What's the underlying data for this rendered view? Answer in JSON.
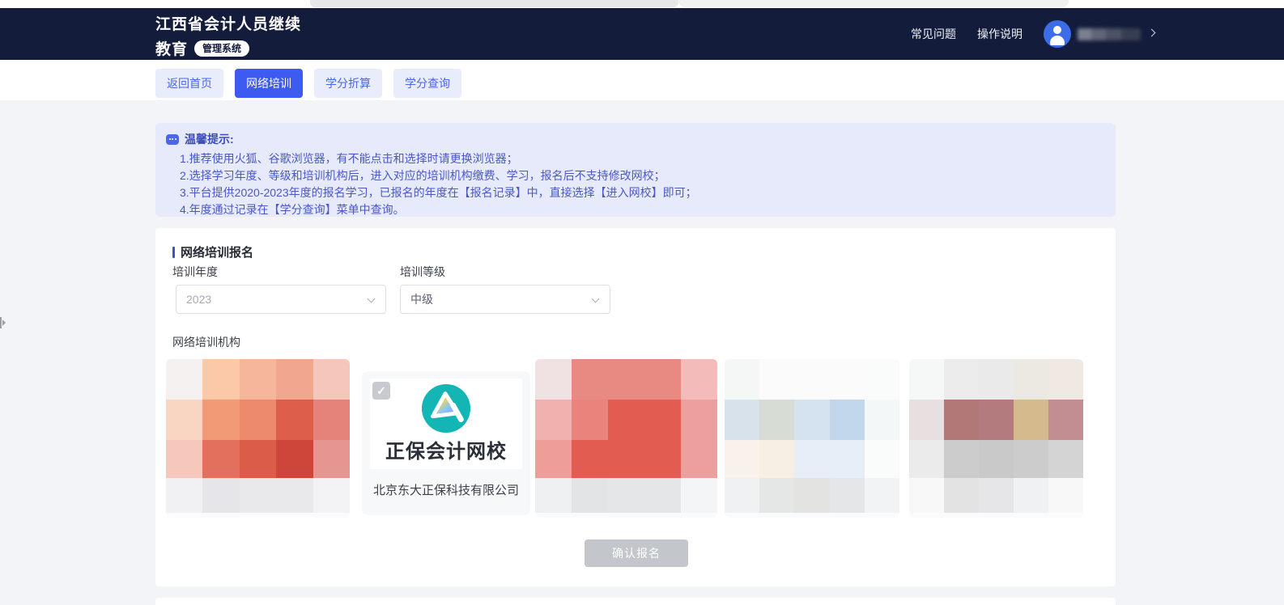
{
  "header": {
    "title_line1": "江西省会计人员继续",
    "title_line2": "教育",
    "badge": "管理系统",
    "links": [
      {
        "label": "常见问题"
      },
      {
        "label": "操作说明"
      }
    ]
  },
  "nav": {
    "tabs": [
      {
        "label": "返回首页",
        "active": false
      },
      {
        "label": "网络培训",
        "active": true
      },
      {
        "label": "学分折算",
        "active": false
      },
      {
        "label": "学分查询",
        "active": false
      }
    ]
  },
  "notice": {
    "title": "温馨提示:",
    "lines": [
      "1.推荐使用火狐、谷歌浏览器，有不能点击和选择时请更换浏览器；",
      "2.选择学习年度、等级和培训机构后，进入对应的培训机构缴费、学习，报名后不支持修改网校；",
      "3.平台提供2020-2023年度的报名学习，已报名的年度在【报名记录】中，直接选择【进入网校】即可；",
      "4.年度通过记录在【学分查询】菜单中查询。"
    ]
  },
  "form": {
    "section_title": "网络培训报名",
    "year_label": "培训年度",
    "year_value": "2023",
    "level_label": "培训等级",
    "level_value": "中级",
    "institutions_label": "网络培训机构",
    "confirm_label": "确认报名",
    "checkbox_glyph": "✓"
  },
  "institutions": {
    "cards": [
      {
        "type": "blurred",
        "mosaic": [
          [
            "#f4f1f0",
            "#fbc9a8",
            "#f6b69c",
            "#f1a78f",
            "#f5c6ba"
          ],
          [
            "#f9d6c2",
            "#f29a76",
            "#ee8a6c",
            "#dd5f49",
            "#e4837a"
          ],
          [
            "#f5c8bb",
            "#e2705c",
            "#dc5c4a",
            "#ce453a",
            "#e69690"
          ],
          [
            "#f1f1f3",
            "#e6e6ea",
            "#e9e9eb",
            "#e9e9eb",
            "#f3f3f5"
          ]
        ]
      },
      {
        "type": "selected",
        "checked": true,
        "logo_text": "正保会计网校",
        "company": "北京东大正保科技有限公司"
      },
      {
        "type": "blurred",
        "mosaic": [
          [
            "#f0e2e3",
            "#e98a82",
            "#e98a82",
            "#e98a82",
            "#f3bcba"
          ],
          [
            "#f1b1af",
            "#ea837b",
            "#e25c52",
            "#e25c52",
            "#ec9f9c"
          ],
          [
            "#ef9d99",
            "#e25c52",
            "#e25c52",
            "#e25c52",
            "#ec9f9c"
          ],
          [
            "#eff0f1",
            "#e3e4e6",
            "#e5e6e7",
            "#e5e6e7",
            "#f4f5f6"
          ]
        ]
      },
      {
        "type": "blurred",
        "mosaic": [
          [
            "#f5f7f6",
            "#fbfbfb",
            "#fbfbfb",
            "#fbfbfb",
            "#fafbfb"
          ],
          [
            "#d7e2ea",
            "#d7dcd4",
            "#d5e2ef",
            "#c2d7ec",
            "#f4f7f8"
          ],
          [
            "#f8f2ea",
            "#f7efe3",
            "#e8eef7",
            "#e8eef7",
            "#fafcfc"
          ],
          [
            "#eff1f2",
            "#e5e6e6",
            "#e3e4e2",
            "#e5e6e8",
            "#f2f3f5"
          ]
        ]
      },
      {
        "type": "blurred",
        "mosaic": [
          [
            "#f6f8f7",
            "#ebeceb",
            "#e9eae9",
            "#ece9e3",
            "#efe8e3"
          ],
          [
            "#e8dfe0",
            "#b27877",
            "#b47b7e",
            "#d4ba8c",
            "#c28e92"
          ],
          [
            "#ebebeb",
            "#cccccc",
            "#c9c9c9",
            "#cccccc",
            "#d4d4d4"
          ],
          [
            "#f8f8f8",
            "#e3e3e3",
            "#e6e6e8",
            "#f0f1f2",
            "#f8f8f8"
          ]
        ]
      }
    ]
  },
  "colors": {
    "header_navy": "#131c3a",
    "accent_blue": "#3d5af1",
    "tab_inactive_bg": "#e9ecfb",
    "notice_bg": "#e7eafa",
    "notice_text": "#4a58c6",
    "logo_teal": "#14b5b5",
    "disabled_button": "#c3c6cb"
  }
}
